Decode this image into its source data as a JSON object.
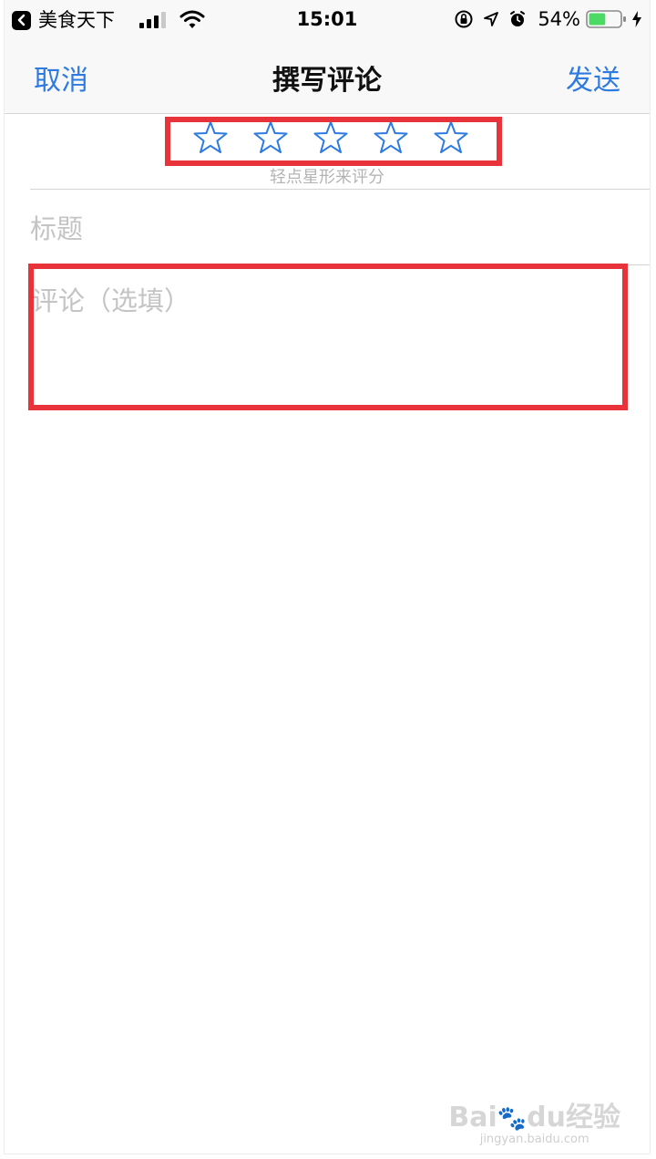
{
  "status_bar": {
    "back_app_name": "美食天下",
    "time": "15:01",
    "battery_percent": "54%",
    "battery_level": 0.54,
    "icons": [
      "back-chevron-icon",
      "signal-icon",
      "wifi-icon",
      "orientation-lock-icon",
      "location-arrow-icon",
      "alarm-icon",
      "battery-icon",
      "charging-bolt-icon"
    ]
  },
  "nav": {
    "cancel_label": "取消",
    "title": "撰写评论",
    "send_label": "发送"
  },
  "rating": {
    "star_count": 5,
    "selected": 0,
    "hint": "轻点星形来评分"
  },
  "form": {
    "title_placeholder": "标题",
    "comment_placeholder": "评论（选填）"
  },
  "watermark": {
    "logo_text": "Bai",
    "logo_text2": "du",
    "logo_cn": "经验",
    "url": "jingyan.baidu.com"
  },
  "colors": {
    "accent": "#2d7ae0",
    "highlight_box": "#e8333a",
    "placeholder": "#c4c4c6"
  }
}
